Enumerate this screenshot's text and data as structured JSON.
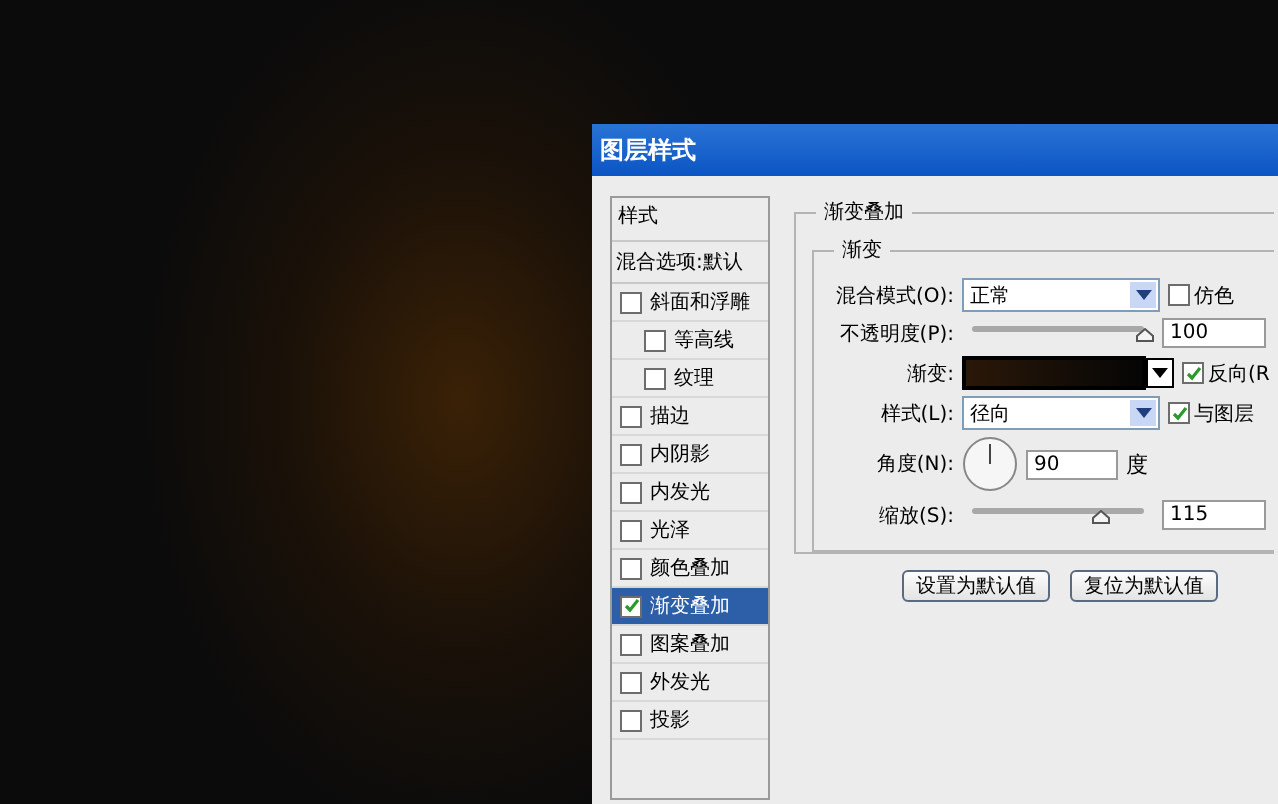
{
  "window": {
    "title": "图层样式"
  },
  "styles_list": {
    "header": "样式",
    "blend_options": "混合选项:默认",
    "items": [
      {
        "label": "斜面和浮雕",
        "checked": false,
        "selected": false,
        "children": [
          {
            "label": "等高线",
            "checked": false,
            "selected": false
          },
          {
            "label": "纹理",
            "checked": false,
            "selected": false
          }
        ]
      },
      {
        "label": "描边",
        "checked": false,
        "selected": false
      },
      {
        "label": "内阴影",
        "checked": false,
        "selected": false
      },
      {
        "label": "内发光",
        "checked": false,
        "selected": false
      },
      {
        "label": "光泽",
        "checked": false,
        "selected": false
      },
      {
        "label": "颜色叠加",
        "checked": false,
        "selected": false
      },
      {
        "label": "渐变叠加",
        "checked": true,
        "selected": true
      },
      {
        "label": "图案叠加",
        "checked": false,
        "selected": false
      },
      {
        "label": "外发光",
        "checked": false,
        "selected": false
      },
      {
        "label": "投影",
        "checked": false,
        "selected": false
      }
    ]
  },
  "gradient_overlay": {
    "title": "渐变叠加",
    "section": "渐变",
    "blend_mode": {
      "label": "混合模式(O):",
      "value": "正常"
    },
    "dither": {
      "label": "仿色",
      "checked": false
    },
    "opacity": {
      "label": "不透明度(P):",
      "level": 1,
      "value": "100"
    },
    "gradient": {
      "label": "渐变:"
    },
    "reverse": {
      "label": "反向(R",
      "checked": true
    },
    "style": {
      "label": "样式(L):",
      "value": "径向"
    },
    "align": {
      "label": "与图层",
      "checked": true
    },
    "angle": {
      "label": "角度(N):",
      "value": "90",
      "unit": "度"
    },
    "scale": {
      "label": "缩放(S):",
      "level": 0.75,
      "value": "115"
    }
  },
  "buttons": [
    "设置为默认值",
    "复位为默认值"
  ]
}
